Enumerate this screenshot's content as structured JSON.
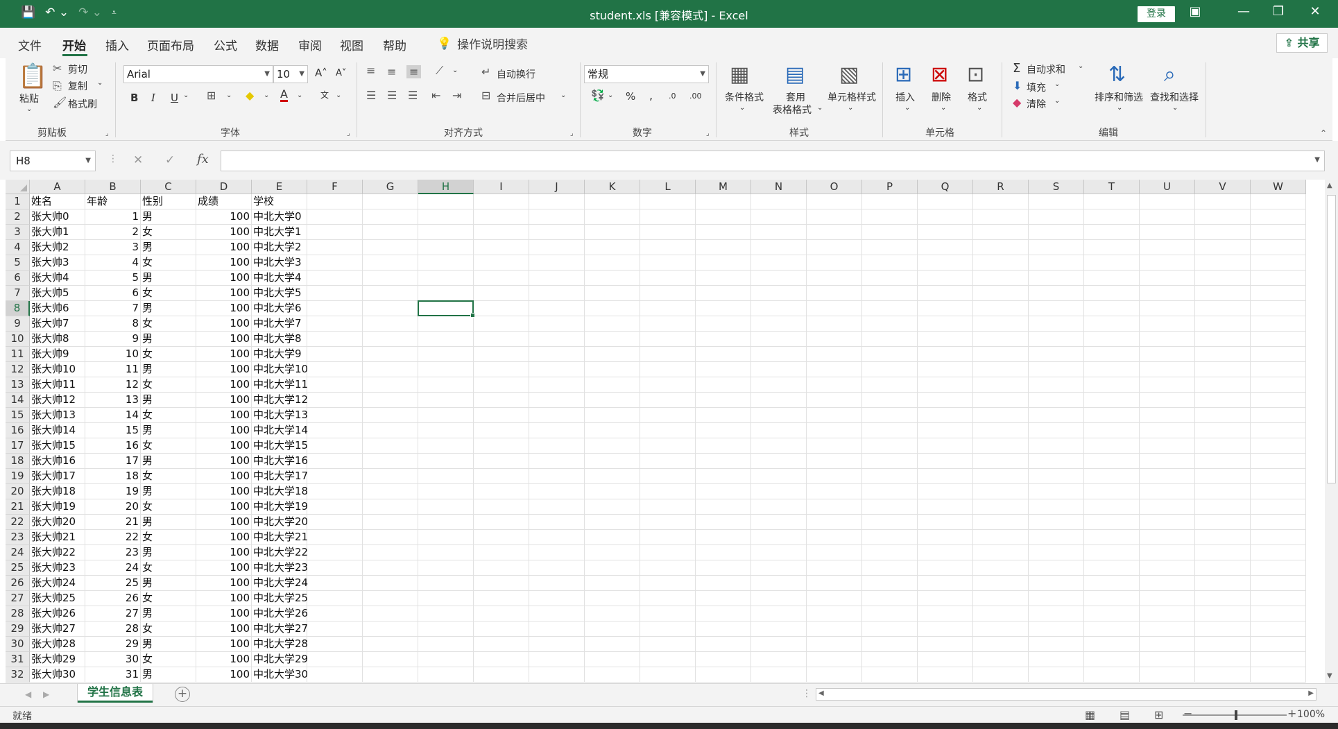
{
  "titlebar": {
    "title": "student.xls  [兼容模式]  -  Excel",
    "login_label": "登录",
    "accent": "#217346"
  },
  "ribbon_tabs": [
    "文件",
    "开始",
    "插入",
    "页面布局",
    "公式",
    "数据",
    "审阅",
    "视图",
    "帮助"
  ],
  "active_tab": "开始",
  "tell_me": "操作说明搜索",
  "share_label": "共享",
  "clipboard": {
    "paste": "粘贴",
    "cut": "剪切",
    "copy": "复制",
    "format_painter": "格式刷",
    "group": "剪贴板"
  },
  "font": {
    "name": "Arial",
    "size": "10",
    "bold": "B",
    "italic": "I",
    "underline": "U",
    "group": "字体"
  },
  "alignment": {
    "wrap_text": "自动换行",
    "merge_center": "合并后居中",
    "group": "对齐方式"
  },
  "number": {
    "format": "常规",
    "group": "数字"
  },
  "styles": {
    "conditional": "条件格式",
    "table_format_1": "套用",
    "table_format_2": "表格格式",
    "cell_styles": "单元格样式",
    "group": "样式"
  },
  "cells": {
    "insert": "插入",
    "delete": "删除",
    "format": "格式",
    "group": "单元格"
  },
  "editing": {
    "autosum": "自动求和",
    "fill": "填充",
    "clear": "清除",
    "sort_filter": "排序和筛选",
    "find_select": "查找和选择",
    "group": "编辑"
  },
  "formula_bar": {
    "name_box": "H8",
    "formula": ""
  },
  "columns": [
    "A",
    "B",
    "C",
    "D",
    "E",
    "F",
    "G",
    "H",
    "I",
    "J",
    "K",
    "L",
    "M",
    "N",
    "O",
    "P",
    "Q",
    "R",
    "S",
    "T",
    "U",
    "V",
    "W"
  ],
  "selected_cell": "H8",
  "rows": [
    [
      "姓名",
      "年龄",
      "性别",
      "成绩",
      "学校"
    ],
    [
      "张大帅0",
      "1",
      "男",
      "100",
      "中北大学0"
    ],
    [
      "张大帅1",
      "2",
      "女",
      "100",
      "中北大学1"
    ],
    [
      "张大帅2",
      "3",
      "男",
      "100",
      "中北大学2"
    ],
    [
      "张大帅3",
      "4",
      "女",
      "100",
      "中北大学3"
    ],
    [
      "张大帅4",
      "5",
      "男",
      "100",
      "中北大学4"
    ],
    [
      "张大帅5",
      "6",
      "女",
      "100",
      "中北大学5"
    ],
    [
      "张大帅6",
      "7",
      "男",
      "100",
      "中北大学6"
    ],
    [
      "张大帅7",
      "8",
      "女",
      "100",
      "中北大学7"
    ],
    [
      "张大帅8",
      "9",
      "男",
      "100",
      "中北大学8"
    ],
    [
      "张大帅9",
      "10",
      "女",
      "100",
      "中北大学9"
    ],
    [
      "张大帅10",
      "11",
      "男",
      "100",
      "中北大学10"
    ],
    [
      "张大帅11",
      "12",
      "女",
      "100",
      "中北大学11"
    ],
    [
      "张大帅12",
      "13",
      "男",
      "100",
      "中北大学12"
    ],
    [
      "张大帅13",
      "14",
      "女",
      "100",
      "中北大学13"
    ],
    [
      "张大帅14",
      "15",
      "男",
      "100",
      "中北大学14"
    ],
    [
      "张大帅15",
      "16",
      "女",
      "100",
      "中北大学15"
    ],
    [
      "张大帅16",
      "17",
      "男",
      "100",
      "中北大学16"
    ],
    [
      "张大帅17",
      "18",
      "女",
      "100",
      "中北大学17"
    ],
    [
      "张大帅18",
      "19",
      "男",
      "100",
      "中北大学18"
    ],
    [
      "张大帅19",
      "20",
      "女",
      "100",
      "中北大学19"
    ],
    [
      "张大帅20",
      "21",
      "男",
      "100",
      "中北大学20"
    ],
    [
      "张大帅21",
      "22",
      "女",
      "100",
      "中北大学21"
    ],
    [
      "张大帅22",
      "23",
      "男",
      "100",
      "中北大学22"
    ],
    [
      "张大帅23",
      "24",
      "女",
      "100",
      "中北大学23"
    ],
    [
      "张大帅24",
      "25",
      "男",
      "100",
      "中北大学24"
    ],
    [
      "张大帅25",
      "26",
      "女",
      "100",
      "中北大学25"
    ],
    [
      "张大帅26",
      "27",
      "男",
      "100",
      "中北大学26"
    ],
    [
      "张大帅27",
      "28",
      "女",
      "100",
      "中北大学27"
    ],
    [
      "张大帅28",
      "29",
      "男",
      "100",
      "中北大学28"
    ],
    [
      "张大帅29",
      "30",
      "女",
      "100",
      "中北大学29"
    ],
    [
      "张大帅30",
      "31",
      "男",
      "100",
      "中北大学30"
    ]
  ],
  "sheet_tab": "学生信息表",
  "status": "就绪",
  "zoom": "100%"
}
